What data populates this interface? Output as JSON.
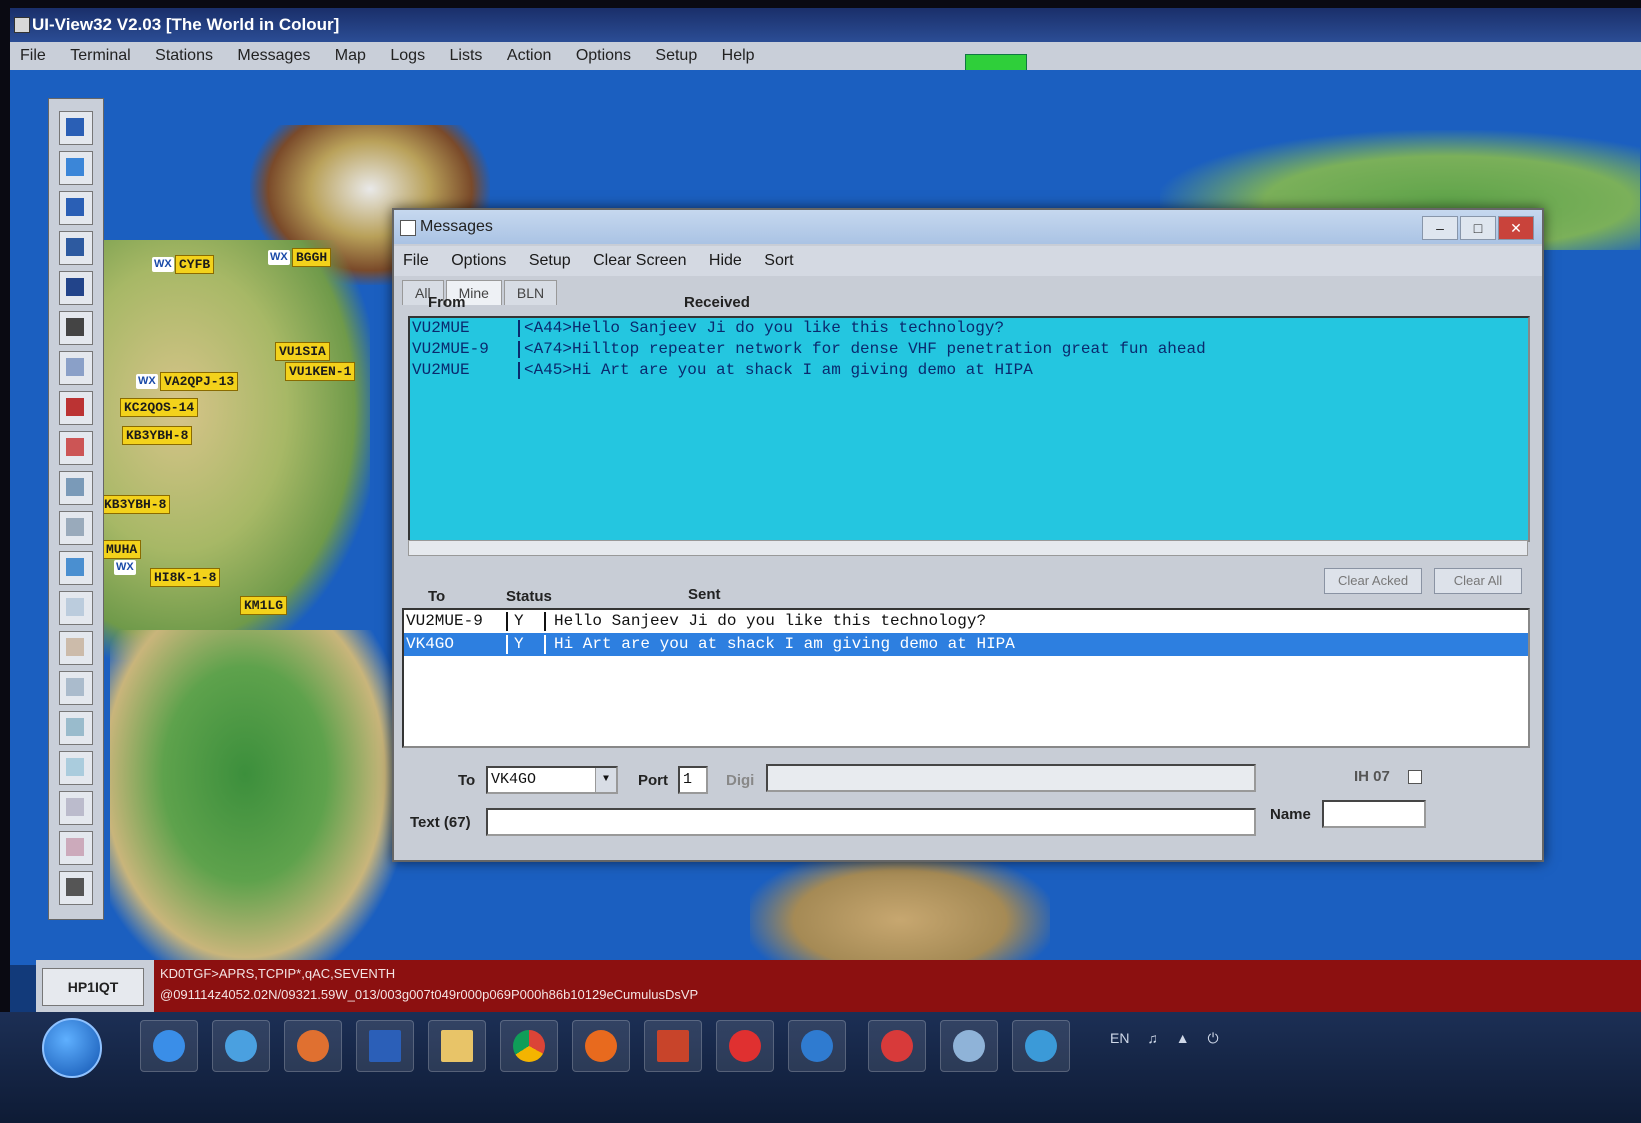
{
  "app": {
    "title": "UI-View32 V2.03 [The World in Colour]"
  },
  "menubar": [
    "File",
    "Terminal",
    "Stations",
    "Messages",
    "Map",
    "Logs",
    "Lists",
    "Action",
    "Options",
    "Setup",
    "Help"
  ],
  "map": {
    "callsigns": [
      "CYFB",
      "BGGH",
      "VU1SIA",
      "VU1KEN-1",
      "VA2QPJ-13",
      "KC2QOS-14",
      "KB3YBH-8",
      "KB3YBH-8",
      "MUHA",
      "HI8K-1-8",
      "KM1LG"
    ],
    "wx_label": "WX"
  },
  "messages_window": {
    "title": "Messages",
    "menu": [
      "File",
      "Options",
      "Setup",
      "Clear Screen",
      "Hide",
      "Sort"
    ],
    "tabs": [
      "All",
      "Mine",
      "BLN"
    ],
    "received_headers": {
      "from": "From",
      "received": "Received"
    },
    "received": [
      {
        "from": "VU2MUE",
        "text": "<A44>Hello Sanjeev Ji do you like this technology?"
      },
      {
        "from": "VU2MUE-9",
        "text": "<A74>Hilltop repeater network for dense VHF penetration great fun ahead"
      },
      {
        "from": "VU2MUE",
        "text": "<A45>Hi Art are you at shack I am giving demo at HIPA"
      }
    ],
    "buttons": {
      "clear_acked": "Clear Acked",
      "clear_all": "Clear All"
    },
    "sent_headers": {
      "to": "To",
      "status": "Status",
      "sent": "Sent"
    },
    "sent": [
      {
        "to": "VU2MUE-9",
        "status": "Y",
        "text": "Hello Sanjeev Ji do you like this technology?",
        "selected": false
      },
      {
        "to": "VK4GO",
        "status": "Y",
        "text": "Hi Art are you at shack I am giving demo at HIPA",
        "selected": true
      }
    ],
    "compose": {
      "to_label": "To",
      "to_value": "VK4GO",
      "port_label": "Port",
      "port_value": "1",
      "digi_label": "Digi",
      "digi_value": "",
      "text_label": "Text (67)",
      "text_value": "",
      "ih_label": "IH 07",
      "name_label": "Name",
      "name_value": ""
    }
  },
  "statusbar": {
    "station": "HP1IQT",
    "packet_line1": "KD0TGF>APRS,TCPIP*,qAC,SEVENTH",
    "packet_line2": "@091114z4052.02N/09321.59W_013/003g007t049r000p069P000h86b10129eCumulusDsVP"
  },
  "taskbar": {
    "apps": [
      "ie-icon",
      "network-icon",
      "media-player-icon",
      "stocks-icon",
      "explorer-icon",
      "chrome-icon",
      "firefox-icon",
      "powerpoint-icon",
      "ui-view-icon",
      "globe-icon",
      "magnet-icon",
      "satellite-icon",
      "search-globe-icon"
    ],
    "tray_lang": "EN"
  },
  "colors": {
    "received_bg": "#24c6e0",
    "selected_row": "#2d7fe0",
    "callsign_bg": "#f3d21b",
    "packet_bg": "#8c1010"
  }
}
